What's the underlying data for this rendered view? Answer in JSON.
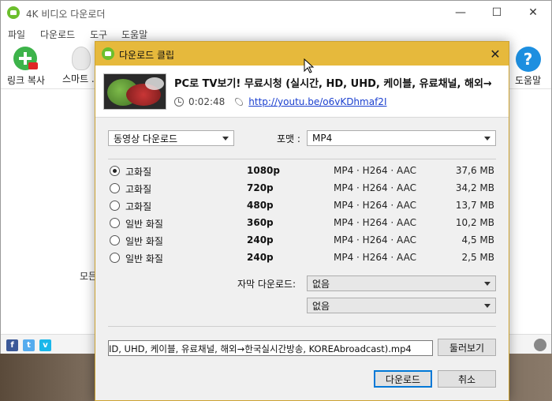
{
  "app": {
    "title": "4K 비디오 다운로더",
    "menu": [
      "파일",
      "다운로드",
      "도구",
      "도움말"
    ],
    "toolbar": {
      "paste_link_label": "링크 복사",
      "smart_mode_label": "스마트 ...",
      "help_label": "도움말"
    },
    "body_text_stub": "모든",
    "social": [
      "f",
      "t",
      "v"
    ]
  },
  "dialog": {
    "title": "다운로드 클립",
    "clip": {
      "title": "PC로 TV보기! 무료시청 (실시간, HD, UHD, 케이블, 유료채널, 해외→",
      "duration": "0:02:48",
      "url": "http://youtu.be/o6vKDhmaf2I"
    },
    "download_type": "동영상 다운로드",
    "format_label": "포맷 :",
    "format_value": "MP4",
    "qualities": [
      {
        "label": "고화질",
        "resolution": "1080p",
        "codec": "MP4 · H264 · AAC",
        "size": "37,6 MB",
        "selected": true
      },
      {
        "label": "고화질",
        "resolution": "720p",
        "codec": "MP4 · H264 · AAC",
        "size": "34,2 MB",
        "selected": false
      },
      {
        "label": "고화질",
        "resolution": "480p",
        "codec": "MP4 · H264 · AAC",
        "size": "13,7 MB",
        "selected": false
      },
      {
        "label": "일반 화질",
        "resolution": "360p",
        "codec": "MP4 · H264 · AAC",
        "size": "10,2 MB",
        "selected": false
      },
      {
        "label": "일반 화질",
        "resolution": "240p",
        "codec": "MP4 · H264 · AAC",
        "size": "4,5 MB",
        "selected": false
      },
      {
        "label": "일반 화질",
        "resolution": "240p",
        "codec": "MP4 · H264 · AAC",
        "size": "2,5 MB",
        "selected": false
      }
    ],
    "subtitle_label": "자막 다운로드:",
    "subtitle_value": "없음",
    "subtitle_lang_value": "없음",
    "save_path": "ID, UHD, 케이블, 유료채널, 해외→한국실시간방송, KOREAbroadcast).mp4",
    "browse_label": "둘러보기",
    "download_label": "다운로드",
    "cancel_label": "취소"
  }
}
